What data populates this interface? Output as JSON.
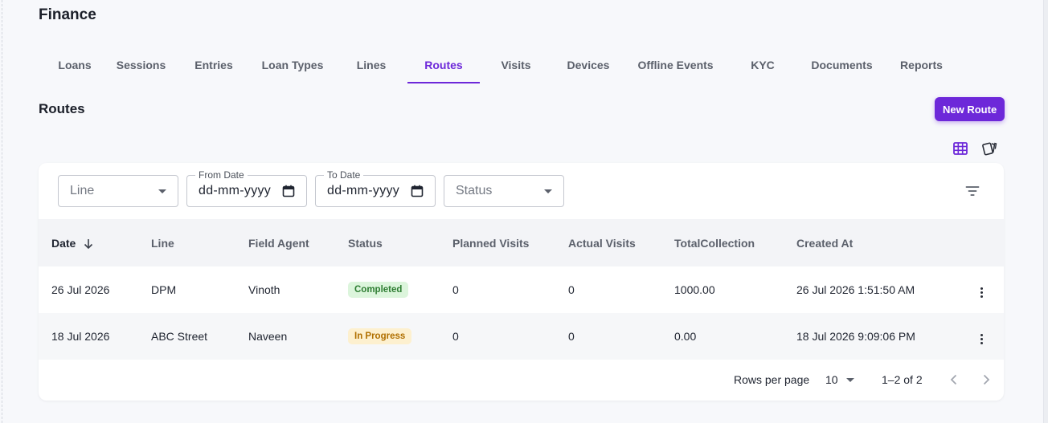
{
  "app": {
    "title": "Finance"
  },
  "tabs": [
    {
      "label": "Loans",
      "width": 74
    },
    {
      "label": "Sessions",
      "width": 91
    },
    {
      "label": "Entries",
      "width": 90
    },
    {
      "label": "Loan Types",
      "width": 106
    },
    {
      "label": "Lines",
      "width": 90
    },
    {
      "label": "Routes",
      "width": 90
    },
    {
      "label": "Visits",
      "width": 90
    },
    {
      "label": "Devices",
      "width": 90
    },
    {
      "label": "Offline Events",
      "width": 127
    },
    {
      "label": "KYC",
      "width": 90
    },
    {
      "label": "Documents",
      "width": 107
    },
    {
      "label": "Reports",
      "width": 91
    }
  ],
  "active_tab": "Routes",
  "section": {
    "title": "Routes",
    "new_button": "New Route"
  },
  "view_toggle": {
    "table_icon": "table-grid-icon",
    "card_icon": "cards-icon",
    "accent": "#6d28d9"
  },
  "filters": {
    "line_placeholder": "Line",
    "from_date_label": "From Date",
    "from_date_value": "dd-mm-yyyy",
    "to_date_label": "To Date",
    "to_date_value": "dd-mm-yyyy",
    "status_placeholder": "Status"
  },
  "table": {
    "columns": [
      "Date",
      "Line",
      "Field Agent",
      "Status",
      "Planned Visits",
      "Actual Visits",
      "TotalCollection",
      "Created At"
    ],
    "sort_indicator": "arrow-down-icon",
    "rows": [
      {
        "date": "26 Jul 2026",
        "line": "DPM",
        "agent": "Vinoth",
        "status": "Completed",
        "status_kind": "completed",
        "planned": "0",
        "actual": "0",
        "collection": "1000.00",
        "created": "26 Jul 2026 1:51:50 AM"
      },
      {
        "date": "18 Jul 2026",
        "line": "ABC Street",
        "agent": "Naveen",
        "status": "In Progress",
        "status_kind": "progress",
        "planned": "0",
        "actual": "0",
        "collection": "0.00",
        "created": "18 Jul 2026 9:09:06 PM"
      }
    ]
  },
  "pagination": {
    "rows_per_page_label": "Rows per page",
    "rows_per_page": "10",
    "range": "1–2 of 2"
  },
  "colors": {
    "primary": "#6d28d9",
    "completed_bg": "#dcf5dc",
    "completed_fg": "#2e7d32",
    "progress_bg": "#fdf0cf",
    "progress_fg": "#b06f00"
  }
}
